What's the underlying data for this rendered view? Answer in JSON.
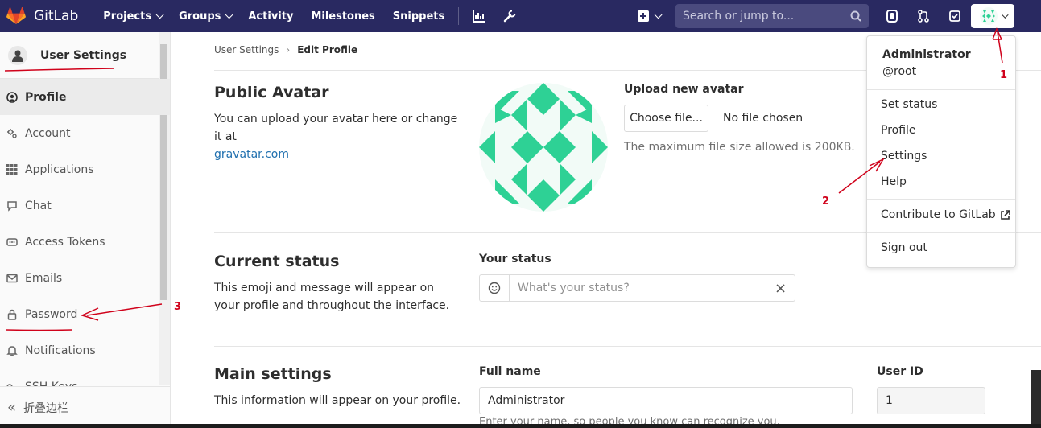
{
  "topnav": {
    "brand": "GitLab",
    "links": [
      {
        "label": "Projects",
        "caret": true
      },
      {
        "label": "Groups",
        "caret": true
      },
      {
        "label": "Activity",
        "caret": false
      },
      {
        "label": "Milestones",
        "caret": false
      },
      {
        "label": "Snippets",
        "caret": false
      }
    ],
    "search_placeholder": "Search or jump to...",
    "icons": [
      "chart-icon",
      "wrench-icon",
      "plus-square-icon",
      "issues-icon",
      "merge-request-icon",
      "todo-check-icon",
      "user-avatar-icon"
    ],
    "bg_color": "#292961"
  },
  "sidebar": {
    "title": "User Settings",
    "items": [
      {
        "label": "Profile",
        "icon": "profile-icon",
        "active": true
      },
      {
        "label": "Account",
        "icon": "account-gear-icon",
        "active": false
      },
      {
        "label": "Applications",
        "icon": "applications-grid-icon",
        "active": false
      },
      {
        "label": "Chat",
        "icon": "chat-icon",
        "active": false
      },
      {
        "label": "Access Tokens",
        "icon": "token-icon",
        "active": false
      },
      {
        "label": "Emails",
        "icon": "email-icon",
        "active": false
      },
      {
        "label": "Password",
        "icon": "lock-icon",
        "active": false
      },
      {
        "label": "Notifications",
        "icon": "bell-icon",
        "active": false
      },
      {
        "label": "SSH Keys",
        "icon": "key-icon",
        "active": false
      }
    ],
    "collapse_label": "折叠边栏"
  },
  "breadcrumb": {
    "parent": "User Settings",
    "separator": "›",
    "current": "Edit Profile"
  },
  "avatar_section": {
    "title": "Public Avatar",
    "desc_prefix": "You can upload your avatar here or change it at",
    "desc_link": "gravatar.com",
    "upload_label": "Upload new avatar",
    "choose_button": "Choose file...",
    "no_file": "No file chosen",
    "max_size": "The maximum file size allowed is 200KB."
  },
  "status_section": {
    "title": "Current status",
    "desc": "This emoji and message will appear on your profile and throughout the interface.",
    "label": "Your status",
    "placeholder": "What's your status?",
    "clear": "×"
  },
  "main_section": {
    "title": "Main settings",
    "desc": "This information will appear on your profile.",
    "full_name_label": "Full name",
    "full_name_value": "Administrator",
    "full_name_help": "Enter your name, so people you know can recognize you.",
    "user_id_label": "User ID",
    "user_id_value": "1"
  },
  "dropdown": {
    "name": "Administrator",
    "username": "@root",
    "items": [
      "Set status",
      "Profile",
      "Settings",
      "Help"
    ],
    "contribute": "Contribute to GitLab",
    "sign_out": "Sign out"
  },
  "annotations": {
    "step1": "1",
    "step2": "2",
    "step3": "3",
    "color": "#d0021b"
  },
  "colors": {
    "accent_green": "#2ed195",
    "link": "#1f6fae"
  }
}
